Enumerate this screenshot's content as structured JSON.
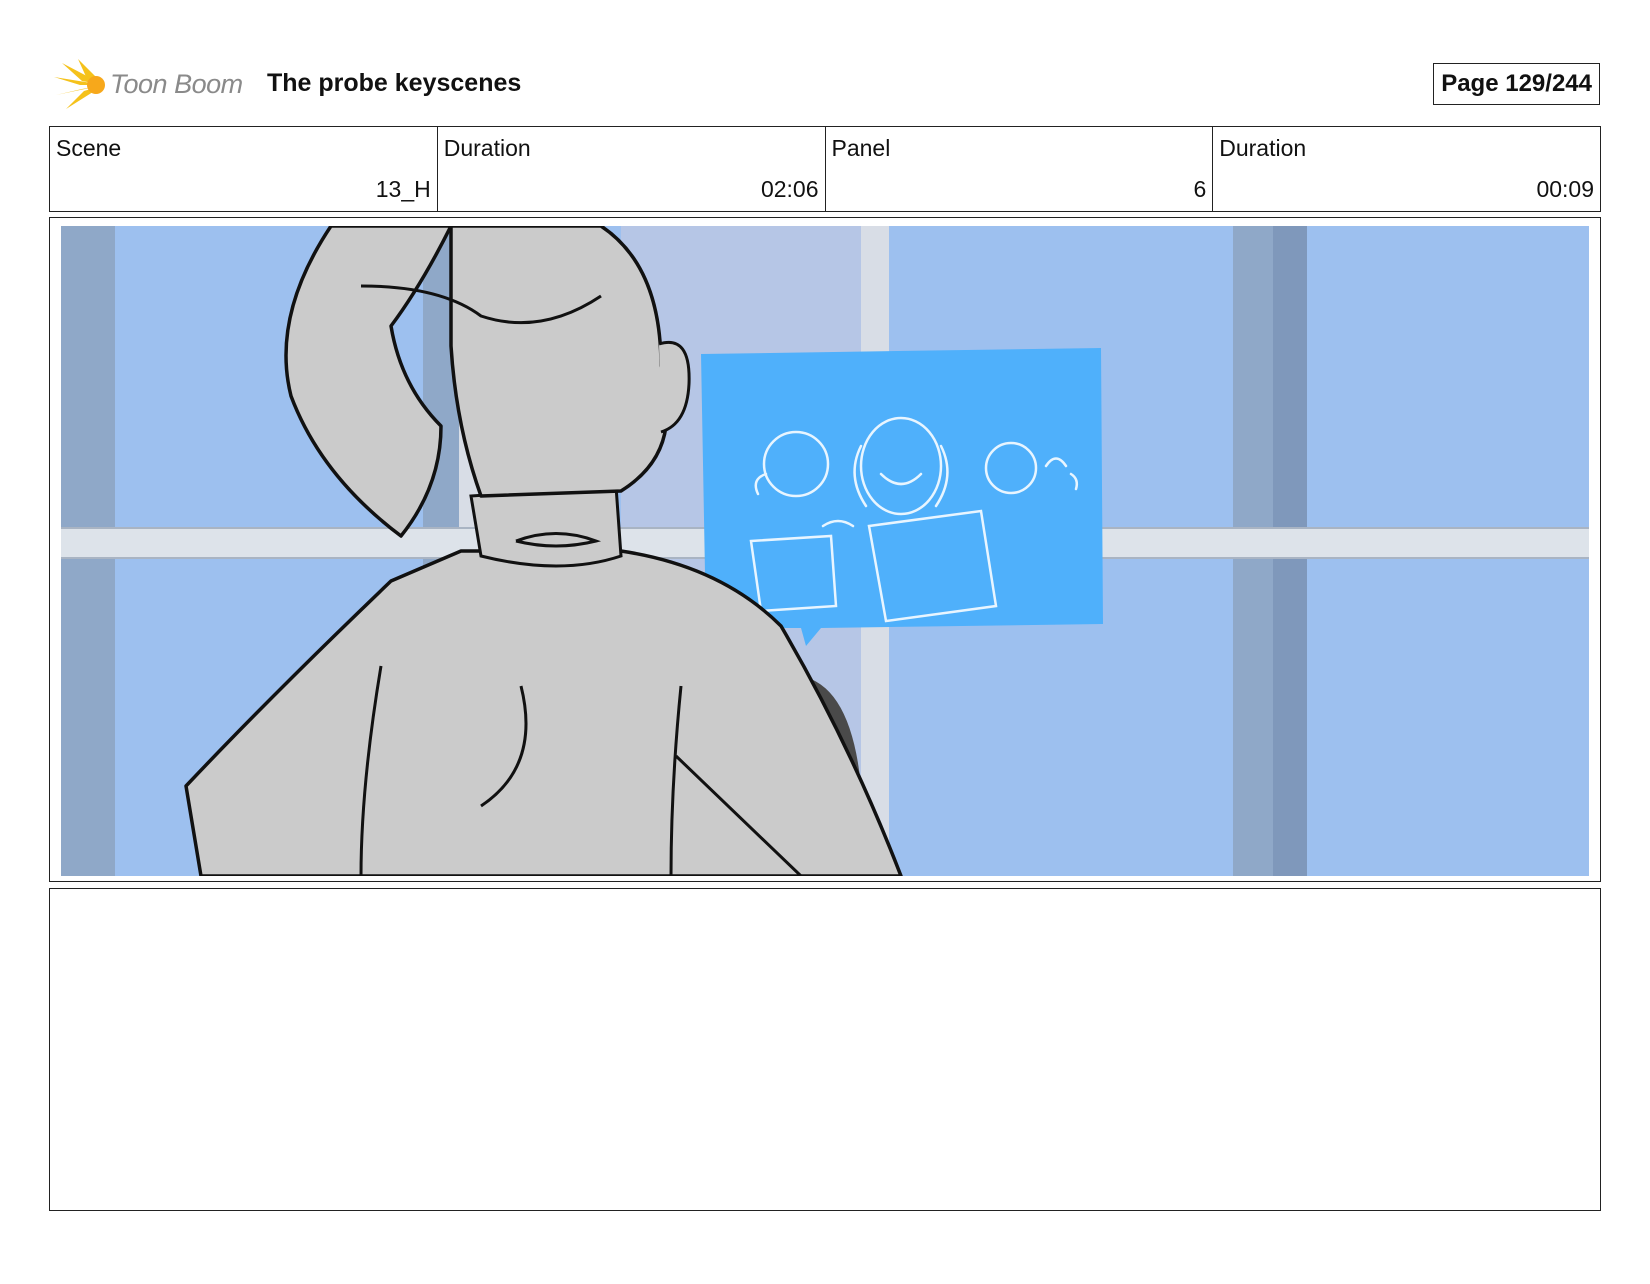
{
  "header": {
    "logo_text": "Toon Boom",
    "title": "The probe keyscenes",
    "page_label": "Page 129/244"
  },
  "info": {
    "scene_label": "Scene",
    "scene_value": "13_H",
    "scene_duration_label": "Duration",
    "scene_duration_value": "02:06",
    "panel_label": "Panel",
    "panel_value": "6",
    "panel_duration_label": "Duration",
    "panel_duration_value": "00:09"
  },
  "colors": {
    "logo_yellow": "#f5c21b",
    "window_blue": "#9dc0ef",
    "frame_blue": "#8fa8c8",
    "screen_blue": "#4fb0fb",
    "figure_gray": "#cbcbcb"
  },
  "notes": ""
}
